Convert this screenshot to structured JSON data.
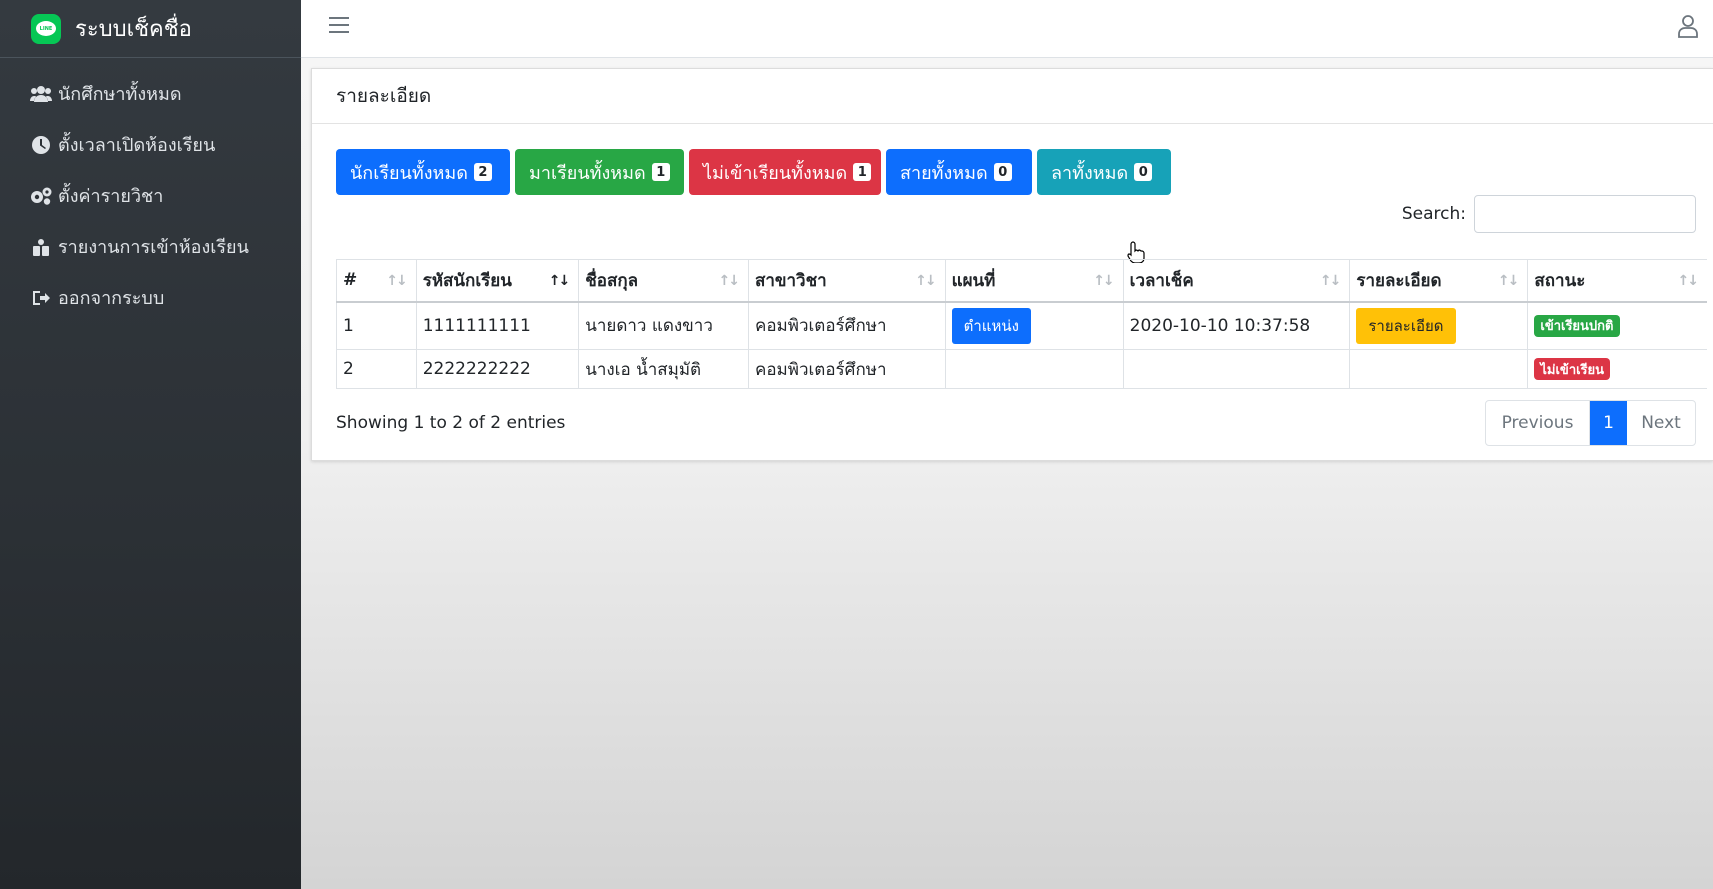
{
  "brand": {
    "title": "ระบบเช็คชื่อ",
    "logo_text": "LINE"
  },
  "sidebar": {
    "items": [
      {
        "label": "นักศึกษาทั้งหมด",
        "icon": "users-icon"
      },
      {
        "label": "ตั้งเวลาเปิดห้องเรียน",
        "icon": "clock-icon"
      },
      {
        "label": "ตั้งค่ารายวิชา",
        "icon": "gears-icon"
      },
      {
        "label": "รายงานการเข้าห้องเรียน",
        "icon": "report-icon"
      },
      {
        "label": "ออกจากระบบ",
        "icon": "sign-out-icon"
      }
    ]
  },
  "card": {
    "title": "รายละเอียด"
  },
  "summary_buttons": [
    {
      "label": "นักเรียนทั้งหมด",
      "count": "2",
      "color": "#0d6efd"
    },
    {
      "label": "มาเรียนทั้งหมด",
      "count": "1",
      "color": "#28a745"
    },
    {
      "label": "ไม่เข้าเรียนทั้งหมด",
      "count": "1",
      "color": "#dc3545"
    },
    {
      "label": "สายทั้งหมด",
      "count": "0",
      "color": "#0d6efd"
    },
    {
      "label": "ลาทั้งหมด",
      "count": "0",
      "color": "#17a2b8"
    }
  ],
  "search": {
    "label": "Search:",
    "value": ""
  },
  "table": {
    "columns": [
      "#",
      "รหัสนักเรียน",
      "ชื่อสกุล",
      "สาขาวิชา",
      "แผนที่",
      "เวลาเช็ค",
      "รายละเอียด",
      "สถานะ"
    ],
    "rows": [
      {
        "no": "1",
        "student_id": "1111111111",
        "name": "นายดาว แดงขาว",
        "major": "คอมพิวเตอร์ศึกษา",
        "map_button": "ตำแหน่ง",
        "check_time": "2020-10-10 10:37:58",
        "detail_button": "รายละเอียด",
        "status": "เข้าเรียนปกติ"
      },
      {
        "no": "2",
        "student_id": "2222222222",
        "name": "นางเอ น้ำสมุมัติ",
        "major": "คอมพิวเตอร์ศึกษา",
        "map_button": "",
        "check_time": "",
        "detail_button": "",
        "status": "ไม่เข้าเรียน"
      }
    ]
  },
  "footer": {
    "info": "Showing 1 to 2 of 2 entries",
    "previous": "Previous",
    "current_page": "1",
    "next": "Next"
  }
}
